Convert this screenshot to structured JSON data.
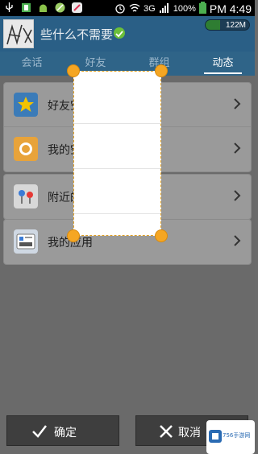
{
  "status_bar": {
    "battery_pct": "100%",
    "network": "3G",
    "time": "PM 4:49"
  },
  "header": {
    "title": "些什么不需要",
    "memory": "122M",
    "memory_used_fraction": 0.33
  },
  "tabs": [
    {
      "label": "会话"
    },
    {
      "label": "好友"
    },
    {
      "label": "群组"
    },
    {
      "label": "动态",
      "active": true
    }
  ],
  "cards": [
    {
      "rows": [
        {
          "label": "好友空间动态",
          "icon": "star-icon"
        },
        {
          "label": "我的空间动态",
          "icon": "bell-icon"
        }
      ]
    },
    {
      "rows": [
        {
          "label": "附近的人",
          "icon": "map-pin-icon"
        }
      ]
    },
    {
      "rows": [
        {
          "label": "我的应用",
          "icon": "apps-icon"
        }
      ]
    }
  ],
  "buttons": {
    "confirm": "确定",
    "cancel": "取消"
  },
  "watermark": {
    "text": "756手游网"
  }
}
